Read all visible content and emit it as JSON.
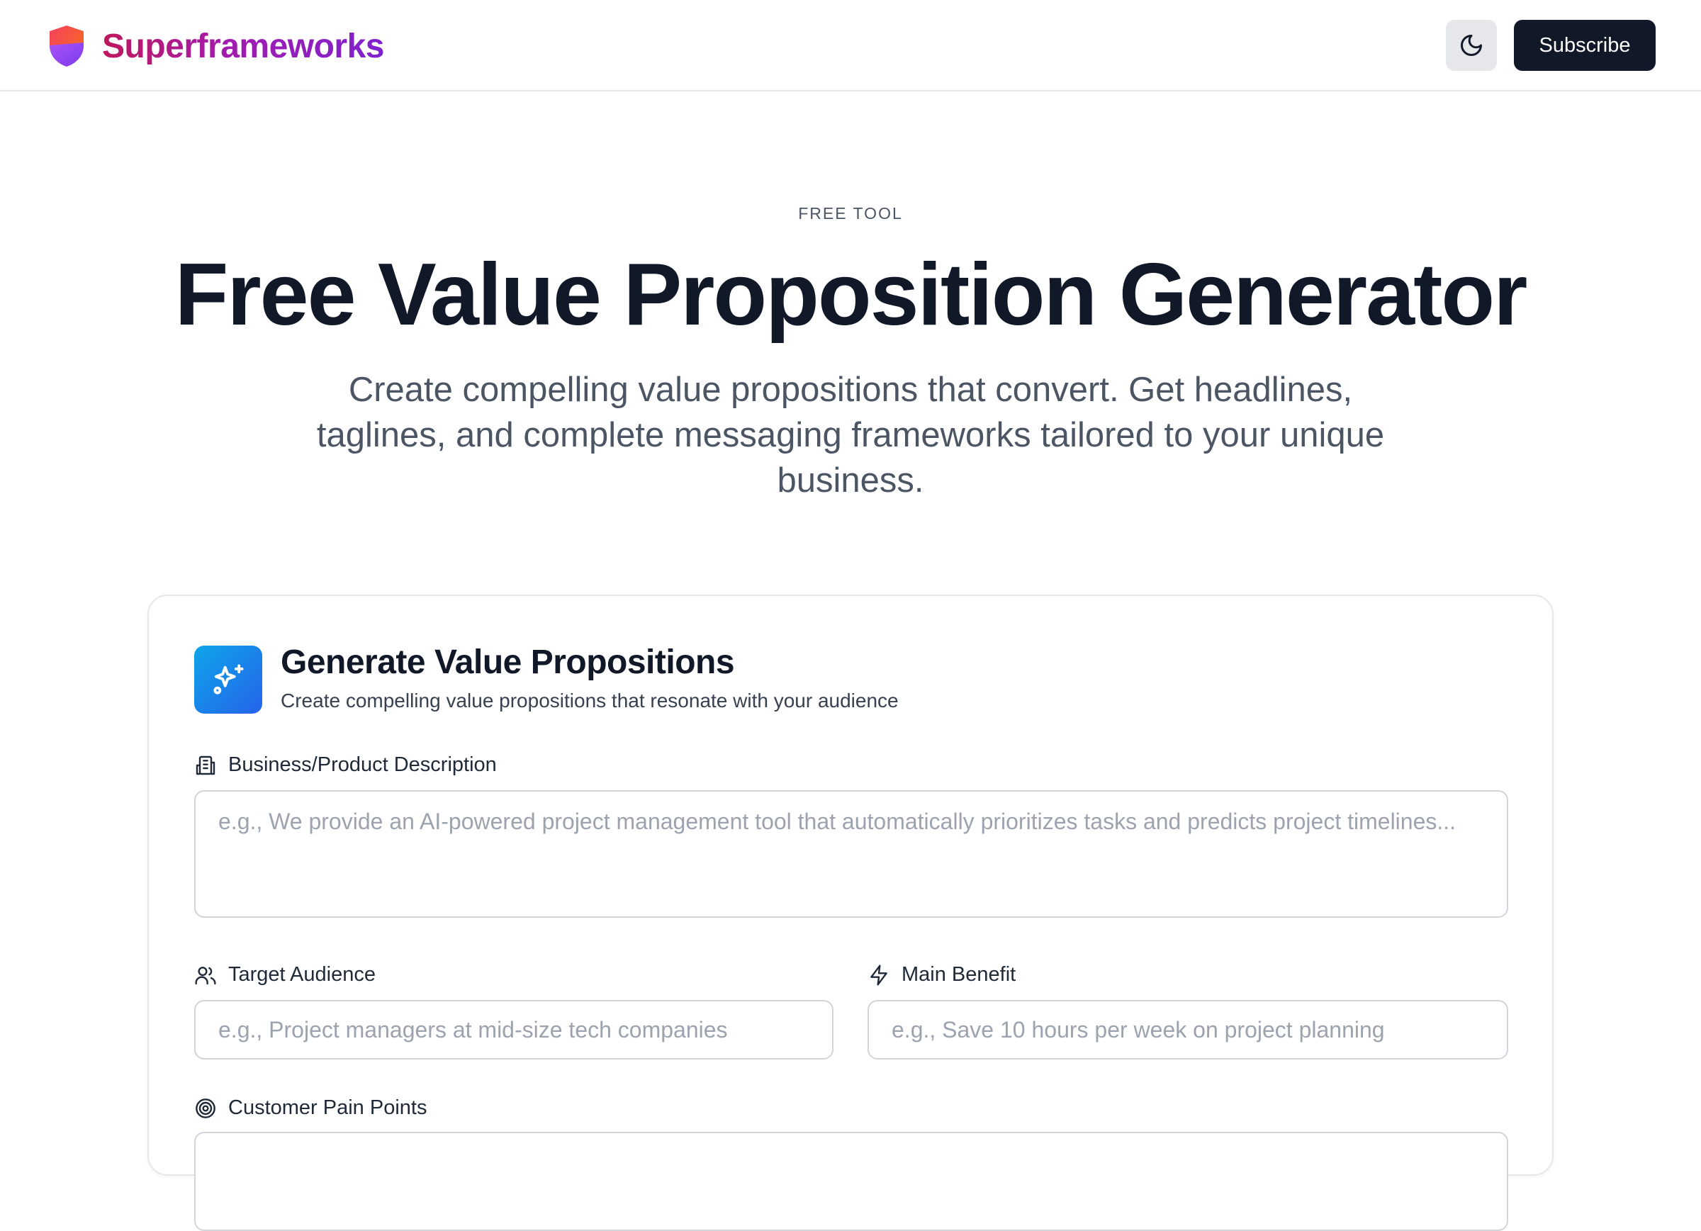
{
  "header": {
    "brand_name": "Superframeworks",
    "theme_toggle_icon": "moon-icon",
    "subscribe_label": "Subscribe"
  },
  "hero": {
    "eyebrow": "FREE TOOL",
    "title": "Free Value Proposition Generator",
    "subtitle": "Create compelling value propositions that convert. Get headlines, taglines, and complete messaging frameworks tailored to your unique business."
  },
  "card": {
    "icon": "sparkles-icon",
    "title": "Generate Value Propositions",
    "description": "Create compelling value propositions that resonate with your audience",
    "fields": {
      "business": {
        "icon": "building-icon",
        "label": "Business/Product Description",
        "value": "",
        "placeholder": "e.g., We provide an AI-powered project management tool that automatically prioritizes tasks and predicts project timelines..."
      },
      "audience": {
        "icon": "users-icon",
        "label": "Target Audience",
        "value": "",
        "placeholder": "e.g., Project managers at mid-size tech companies"
      },
      "benefit": {
        "icon": "zap-icon",
        "label": "Main Benefit",
        "value": "",
        "placeholder": "e.g., Save 10 hours per week on project planning"
      },
      "pain_points": {
        "icon": "target-icon",
        "label": "Customer Pain Points"
      }
    }
  },
  "colors": {
    "brand_gradient_start": "#be185d",
    "brand_gradient_end": "#7e22ce",
    "primary_button": "#111827",
    "card_icon_gradient_start": "#0ea5e9",
    "card_icon_gradient_end": "#2563eb"
  }
}
